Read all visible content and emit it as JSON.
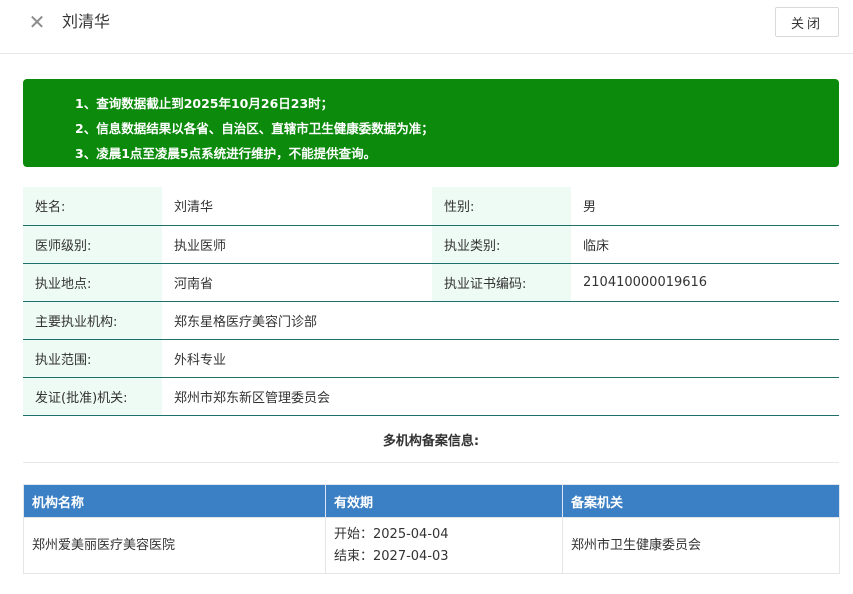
{
  "header": {
    "close_icon": "✕",
    "title": "刘清华",
    "close_button_label": "关闭"
  },
  "notice": {
    "lines": [
      "1、查询数据截止到2025年10月26日23时；",
      "2、信息数据结果以各省、自治区、直辖市卫生健康委数据为准；",
      "3、凌晨1点至凌晨5点系统进行维护，不能提供查询。"
    ]
  },
  "info": {
    "name_label": "姓名:",
    "name_value": "刘清华",
    "gender_label": "性别:",
    "gender_value": "男",
    "level_label": "医师级别:",
    "level_value": "执业医师",
    "category_label": "执业类别:",
    "category_value": "临床",
    "location_label": "执业地点:",
    "location_value": "河南省",
    "cert_label": "执业证书编码:",
    "cert_value": "210410000019616",
    "institution_label": "主要执业机构:",
    "institution_value": "郑东星格医疗美容门诊部",
    "scope_label": "执业范围:",
    "scope_value": "外科专业",
    "issuer_label": "发证(批准)机关:",
    "issuer_value": "郑州市郑东新区管理委员会"
  },
  "records": {
    "title": "多机构备案信息:",
    "columns": [
      "机构名称",
      "有效期",
      "备案机关"
    ],
    "rows": [
      {
        "institution": "郑州爱美丽医疗美容医院",
        "start": "开始：2025-04-04",
        "end": "结束：2027-04-03",
        "authority": "郑州市卫生健康委员会"
      }
    ]
  },
  "colors": {
    "notice_bg": "#0b8a0b",
    "label_bg": "#eefbf5",
    "table_header_bg": "#3b7fc4",
    "row_border": "#1f6f6a"
  }
}
